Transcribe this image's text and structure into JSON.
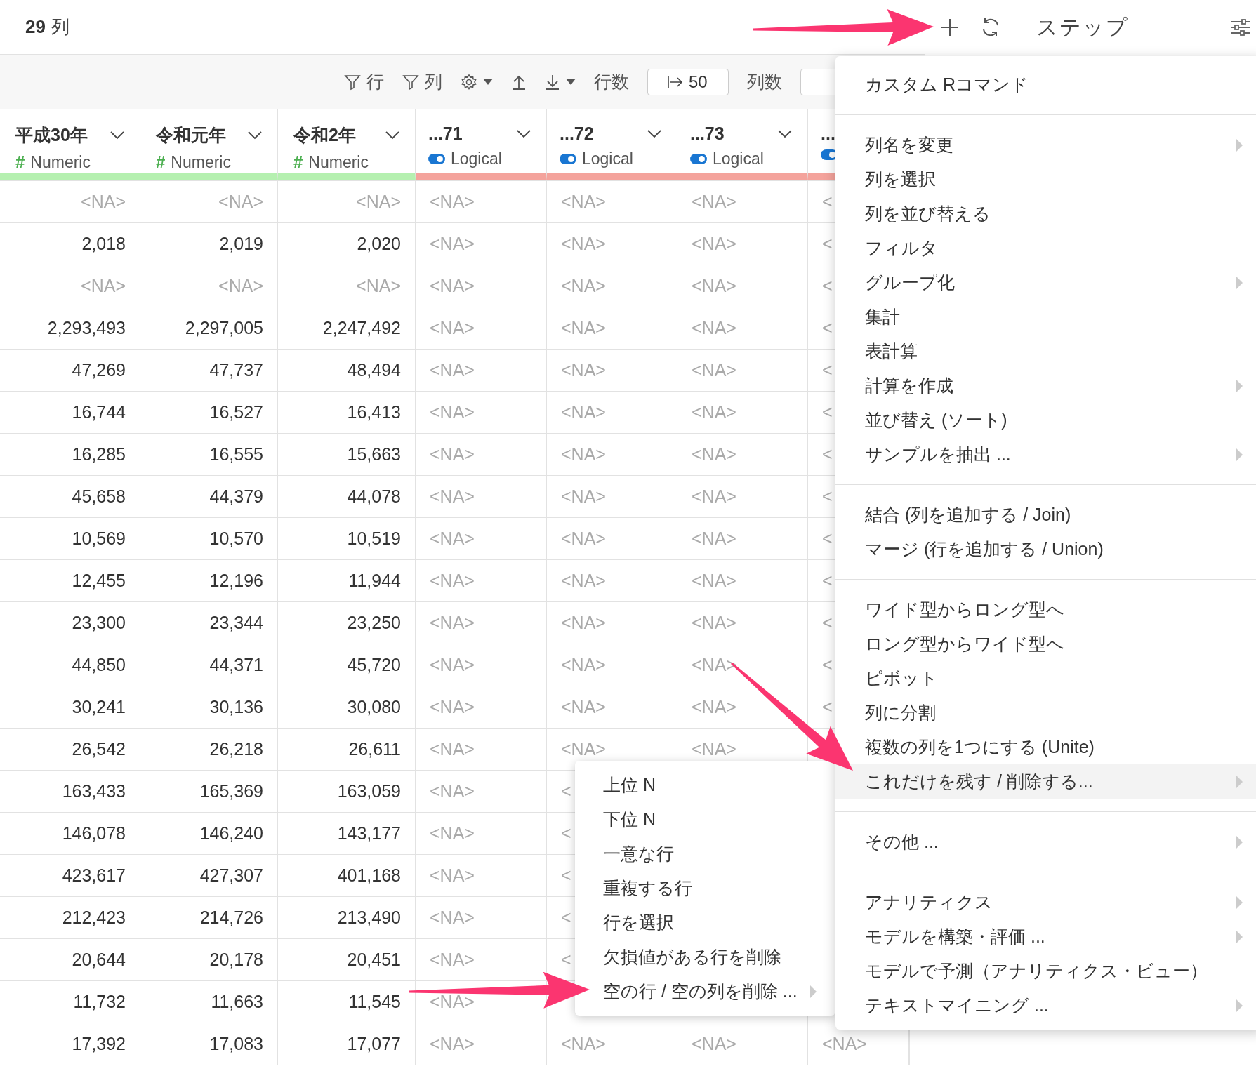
{
  "header": {
    "column_count": "29",
    "column_count_label": "列"
  },
  "steps_panel": {
    "title": "ステップ"
  },
  "toolbar": {
    "row_filter": "行",
    "column_filter": "列",
    "rows_label": "行数",
    "rows_value": "50",
    "columns_label": "列数"
  },
  "table": {
    "columns": [
      {
        "name": "平成30年",
        "kind": "numeric",
        "icon": "#",
        "type": "Numeric"
      },
      {
        "name": "令和元年",
        "kind": "numeric",
        "icon": "#",
        "type": "Numeric"
      },
      {
        "name": "令和2年",
        "kind": "numeric",
        "icon": "#",
        "type": "Numeric"
      },
      {
        "name": "...71",
        "kind": "logical",
        "type": "Logical"
      },
      {
        "name": "...72",
        "kind": "logical",
        "type": "Logical"
      },
      {
        "name": "...73",
        "kind": "logical",
        "type": "Logical"
      },
      {
        "name": "...",
        "kind": "logical"
      }
    ],
    "rows": [
      [
        {
          "na": "<NA>"
        },
        {
          "na": "<NA>"
        },
        {
          "na": "<NA>"
        },
        {
          "na": "<NA>"
        },
        {
          "na": "<NA>"
        },
        {
          "na": "<NA>"
        },
        {
          "na": "<"
        }
      ],
      [
        "2,018",
        "2,019",
        "2,020",
        {
          "na": "<NA>"
        },
        {
          "na": "<NA>"
        },
        {
          "na": "<NA>"
        },
        {
          "na": "<"
        }
      ],
      [
        {
          "na": "<NA>"
        },
        {
          "na": "<NA>"
        },
        {
          "na": "<NA>"
        },
        {
          "na": "<NA>"
        },
        {
          "na": "<NA>"
        },
        {
          "na": "<NA>"
        },
        {
          "na": "<"
        }
      ],
      [
        "2,293,493",
        "2,297,005",
        "2,247,492",
        {
          "na": "<NA>"
        },
        {
          "na": "<NA>"
        },
        {
          "na": "<NA>"
        },
        {
          "na": "<"
        }
      ],
      [
        "47,269",
        "47,737",
        "48,494",
        {
          "na": "<NA>"
        },
        {
          "na": "<NA>"
        },
        {
          "na": "<NA>"
        },
        {
          "na": "<"
        }
      ],
      [
        "16,744",
        "16,527",
        "16,413",
        {
          "na": "<NA>"
        },
        {
          "na": "<NA>"
        },
        {
          "na": "<NA>"
        },
        {
          "na": "<"
        }
      ],
      [
        "16,285",
        "16,555",
        "15,663",
        {
          "na": "<NA>"
        },
        {
          "na": "<NA>"
        },
        {
          "na": "<NA>"
        },
        {
          "na": "<"
        }
      ],
      [
        "45,658",
        "44,379",
        "44,078",
        {
          "na": "<NA>"
        },
        {
          "na": "<NA>"
        },
        {
          "na": "<NA>"
        },
        {
          "na": "<"
        }
      ],
      [
        "10,569",
        "10,570",
        "10,519",
        {
          "na": "<NA>"
        },
        {
          "na": "<NA>"
        },
        {
          "na": "<NA>"
        },
        {
          "na": "<"
        }
      ],
      [
        "12,455",
        "12,196",
        "11,944",
        {
          "na": "<NA>"
        },
        {
          "na": "<NA>"
        },
        {
          "na": "<NA>"
        },
        {
          "na": "<"
        }
      ],
      [
        "23,300",
        "23,344",
        "23,250",
        {
          "na": "<NA>"
        },
        {
          "na": "<NA>"
        },
        {
          "na": "<NA>"
        },
        {
          "na": "<"
        }
      ],
      [
        "44,850",
        "44,371",
        "45,720",
        {
          "na": "<NA>"
        },
        {
          "na": "<NA>"
        },
        {
          "na": "<NA>"
        },
        {
          "na": "<"
        }
      ],
      [
        "30,241",
        "30,136",
        "30,080",
        {
          "na": "<NA>"
        },
        {
          "na": "<NA>"
        },
        {
          "na": "<NA>"
        },
        {
          "na": "<"
        }
      ],
      [
        "26,542",
        "26,218",
        "26,611",
        {
          "na": "<NA>"
        },
        {
          "na": "<NA>"
        },
        {
          "na": "<NA>"
        },
        null
      ],
      [
        "163,433",
        "165,369",
        "163,059",
        {
          "na": "<NA>"
        },
        {
          "na": "<"
        },
        null,
        null
      ],
      [
        "146,078",
        "146,240",
        "143,177",
        {
          "na": "<NA>"
        },
        {
          "na": "<"
        },
        null,
        null
      ],
      [
        "423,617",
        "427,307",
        "401,168",
        {
          "na": "<NA>"
        },
        {
          "na": "<"
        },
        null,
        null
      ],
      [
        "212,423",
        "214,726",
        "213,490",
        {
          "na": "<NA>"
        },
        {
          "na": "<"
        },
        null,
        null
      ],
      [
        "20,644",
        "20,178",
        "20,451",
        {
          "na": "<NA>"
        },
        {
          "na": "<"
        },
        null,
        null
      ],
      [
        "11,732",
        "11,663",
        "11,545",
        {
          "na": "<NA>"
        },
        null,
        null,
        null
      ],
      [
        "17,392",
        "17,083",
        "17,077",
        {
          "na": "<NA>"
        },
        {
          "na": "<NA>"
        },
        {
          "na": "<NA>"
        },
        {
          "na": "<NA>"
        }
      ]
    ]
  },
  "context_menu": {
    "sections": [
      [
        {
          "label": "カスタム Rコマンド",
          "submenu": false,
          "selected": false
        }
      ],
      [
        {
          "label": "列名を変更",
          "submenu": true,
          "selected": false
        },
        {
          "label": "列を選択",
          "submenu": false,
          "selected": false
        },
        {
          "label": "列を並び替える",
          "submenu": false,
          "selected": false
        },
        {
          "label": "フィルタ",
          "submenu": false,
          "selected": false
        },
        {
          "label": "グループ化",
          "submenu": true,
          "selected": false
        },
        {
          "label": "集計",
          "submenu": false,
          "selected": false
        },
        {
          "label": "表計算",
          "submenu": false,
          "selected": false
        },
        {
          "label": "計算を作成",
          "submenu": true,
          "selected": false
        },
        {
          "label": "並び替え (ソート)",
          "submenu": false,
          "selected": false
        },
        {
          "label": "サンプルを抽出 ...",
          "submenu": true,
          "selected": false
        }
      ],
      [
        {
          "label": "結合 (列を追加する / Join)",
          "submenu": false,
          "selected": false
        },
        {
          "label": "マージ (行を追加する / Union)",
          "submenu": false,
          "selected": false
        }
      ],
      [
        {
          "label": "ワイド型からロング型へ",
          "submenu": false,
          "selected": false
        },
        {
          "label": "ロング型からワイド型へ",
          "submenu": false,
          "selected": false
        },
        {
          "label": "ピボット",
          "submenu": false,
          "selected": false
        },
        {
          "label": "列に分割",
          "submenu": false,
          "selected": false
        },
        {
          "label": "複数の列を1つにする (Unite)",
          "submenu": false,
          "selected": false
        },
        {
          "label": "これだけを残す / 削除する...",
          "submenu": true,
          "selected": true
        }
      ],
      [
        {
          "label": "その他 ...",
          "submenu": true,
          "selected": false
        }
      ],
      [
        {
          "label": "アナリティクス",
          "submenu": true,
          "selected": false
        },
        {
          "label": "モデルを構築・評価 ...",
          "submenu": true,
          "selected": false
        },
        {
          "label": "モデルで予測（アナリティクス・ビュー）",
          "submenu": false,
          "selected": false
        },
        {
          "label": "テキストマイニング ...",
          "submenu": true,
          "selected": false
        }
      ]
    ]
  },
  "submenu": {
    "items": [
      {
        "label": "上位 N",
        "submenu": false
      },
      {
        "label": "下位 N",
        "submenu": false
      },
      {
        "label": "一意な行",
        "submenu": false
      },
      {
        "label": "重複する行",
        "submenu": false
      },
      {
        "label": "行を選択",
        "submenu": false
      },
      {
        "label": "欠損値がある行を削除",
        "submenu": false
      },
      {
        "label": "空の行 / 空の列を削除 ...",
        "submenu": true
      }
    ]
  }
}
